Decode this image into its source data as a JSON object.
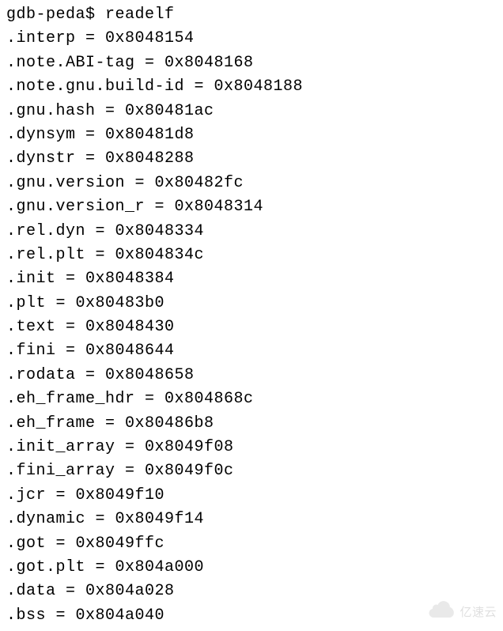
{
  "prompt": "gdb-peda$ ",
  "command": "readelf",
  "sections": [
    {
      "name": ".interp",
      "addr": "0x8048154"
    },
    {
      "name": ".note.ABI-tag",
      "addr": "0x8048168"
    },
    {
      "name": ".note.gnu.build-id",
      "addr": "0x8048188"
    },
    {
      "name": ".gnu.hash",
      "addr": "0x80481ac"
    },
    {
      "name": ".dynsym",
      "addr": "0x80481d8"
    },
    {
      "name": ".dynstr",
      "addr": "0x8048288"
    },
    {
      "name": ".gnu.version",
      "addr": "0x80482fc"
    },
    {
      "name": ".gnu.version_r",
      "addr": "0x8048314"
    },
    {
      "name": ".rel.dyn",
      "addr": "0x8048334"
    },
    {
      "name": ".rel.plt",
      "addr": "0x804834c"
    },
    {
      "name": ".init",
      "addr": "0x8048384"
    },
    {
      "name": ".plt",
      "addr": "0x80483b0"
    },
    {
      "name": ".text",
      "addr": "0x8048430"
    },
    {
      "name": ".fini",
      "addr": "0x8048644"
    },
    {
      "name": ".rodata",
      "addr": "0x8048658"
    },
    {
      "name": ".eh_frame_hdr",
      "addr": "0x804868c"
    },
    {
      "name": ".eh_frame",
      "addr": "0x80486b8"
    },
    {
      "name": ".init_array",
      "addr": "0x8049f08"
    },
    {
      "name": ".fini_array",
      "addr": "0x8049f0c"
    },
    {
      "name": ".jcr",
      "addr": "0x8049f10"
    },
    {
      "name": ".dynamic",
      "addr": "0x8049f14"
    },
    {
      "name": ".got",
      "addr": "0x8049ffc"
    },
    {
      "name": ".got.plt",
      "addr": "0x804a000"
    },
    {
      "name": ".data",
      "addr": "0x804a028"
    },
    {
      "name": ".bss",
      "addr": "0x804a040"
    }
  ],
  "watermark": "亿速云"
}
